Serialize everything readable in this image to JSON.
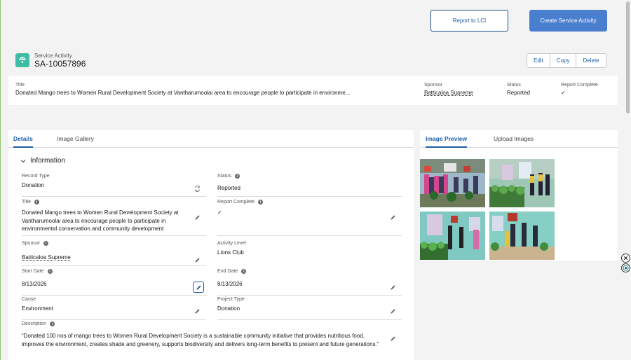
{
  "header": {
    "report_button": "Report to LCI",
    "create_button": "Create Service Activity",
    "object_label": "Service Activity",
    "record_name": "SA-10057896",
    "actions": [
      "Edit",
      "Copy",
      "Delete"
    ]
  },
  "highlights": {
    "title_label": "Title",
    "title_value": "Donated Mango trees to Women Rural Development Society at Vantharumoolai area to encourage people to participate in environme...",
    "sponsor_label": "Sponsor",
    "sponsor_value": "Batticaloa Supreme",
    "status_label": "Status",
    "status_value": "Reported",
    "report_complete_label": "Report Complete",
    "report_complete_value": "✓"
  },
  "left_tabs": [
    "Details",
    "Image Gallery"
  ],
  "right_tabs": [
    "Image Preview",
    "Upload Images"
  ],
  "section": {
    "title": "Information"
  },
  "fields": {
    "record_type": {
      "label": "Record Type",
      "value": "Donation"
    },
    "status": {
      "label": "Status",
      "value": "Reported"
    },
    "title": {
      "label": "Title",
      "value": "Donated Mango trees to Women Rural Development Society at Vantharumoolai area to encourage people to participate in environmental conservation and community development"
    },
    "report_complete": {
      "label": "Report Complete",
      "value": "✓"
    },
    "sponsor": {
      "label": "Sponsor",
      "value": "Batticaloa Supreme"
    },
    "activity_level": {
      "label": "Activity Level",
      "value": "Lions Club"
    },
    "start_date": {
      "label": "Start Date",
      "value": "8/13/2026"
    },
    "end_date": {
      "label": "End Date",
      "value": "8/13/2026"
    },
    "cause": {
      "label": "Cause",
      "value": "Environment"
    },
    "project_type": {
      "label": "Project Type",
      "value": "Donation"
    },
    "description": {
      "label": "Description",
      "value": "“Donated 100 nos of mango trees to Women Rural Development Society is a sustainable community initiative that provides nutritious food, improves the environment, creates shade and greenery, supports biodiversity and delivers long-term benefits to present and future generations.”"
    }
  },
  "colors": {
    "brand": "#1b5fa8",
    "primary_button": "#4a7fcf",
    "record_icon": "#3dbca6"
  },
  "icons": [
    "service-activity-icon",
    "chevron-down-icon",
    "info-icon",
    "pencil-icon",
    "change-record-type-icon",
    "close-circle-icon",
    "target-icon"
  ]
}
